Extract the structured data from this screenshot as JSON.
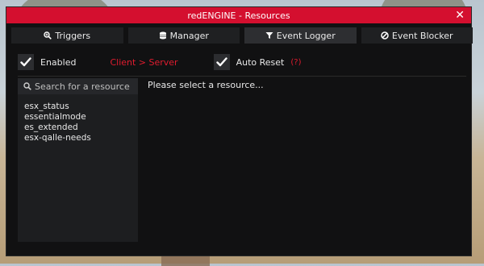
{
  "window": {
    "title": "redENGINE - Resources",
    "close_glyph": "✕"
  },
  "tabs": [
    {
      "label": "Triggers",
      "icon": "search-plus-icon"
    },
    {
      "label": "Manager",
      "icon": "database-icon"
    },
    {
      "label": "Event Logger",
      "icon": "filter-icon",
      "active": true
    },
    {
      "label": "Event Blocker",
      "icon": "ban-icon"
    }
  ],
  "options": {
    "enabled_label": "Enabled",
    "enabled_checked": true,
    "mode_label": "Client > Server",
    "auto_reset_label": "Auto Reset",
    "auto_reset_checked": true,
    "help_label": "(?)"
  },
  "sidebar": {
    "search_placeholder": "Search for a resource",
    "resources": [
      "esx_status",
      "essentialmode",
      "es_extended",
      "esx-qalle-needs"
    ]
  },
  "main": {
    "message": "Please select a resource..."
  },
  "colors": {
    "accent": "#d40f2f",
    "panel": "#111112",
    "text": "#e8e8e8"
  }
}
